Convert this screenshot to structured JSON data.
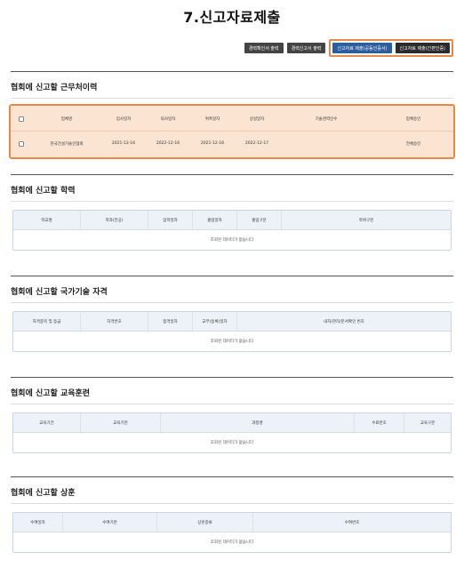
{
  "page": {
    "title": "7.신고자료제출"
  },
  "buttons": {
    "career_print": "경력확인서 출력",
    "career_report_print": "경력신고서 출력",
    "submit_cert": "신고자료 제출(공동인증서)",
    "submit_simple": "신고자료 제출(간편인증)"
  },
  "work_history": {
    "title": "협회에 신고할 근무처이력",
    "headers": [
      "업체명",
      "입사일자",
      "퇴사일자",
      "위촉일자",
      "상실일자",
      "기술경력인수",
      "업체승인"
    ],
    "rows": [
      {
        "company": "한국건설기술인협회",
        "join": "2021-12-16",
        "leave": "2022-12-16",
        "appoint": "2021-12-16",
        "loss": "2022-12-17",
        "career": "",
        "approval": "전체승인"
      }
    ]
  },
  "education": {
    "title": "협회에 신고할 학력",
    "headers": [
      "학교명",
      "학과(전공)",
      "입학일자",
      "졸업일자",
      "졸업구분",
      "학위구분"
    ],
    "empty": "조회된 데이터가 없습니다"
  },
  "license": {
    "title": "협회에 신고할 국가기술 자격",
    "headers": [
      "자격종목 및 등급",
      "자격번호",
      "합격일자",
      "교부(등록)일자",
      "내자/관리/문서확인 번호"
    ],
    "empty": "조회된 데이터가 없습니다"
  },
  "training": {
    "title": "협회에 신고할 교육훈련",
    "headers": [
      "교육기간",
      "교육기관",
      "과정명",
      "수료번호",
      "교육구분"
    ],
    "empty": "조회된 데이터가 없습니다"
  },
  "awards": {
    "title": "협회에 신고할 상훈",
    "headers": [
      "수여일자",
      "수여기관",
      "상훈종류",
      "수여번호"
    ],
    "empty": "조회된 데이터가 없습니다"
  }
}
